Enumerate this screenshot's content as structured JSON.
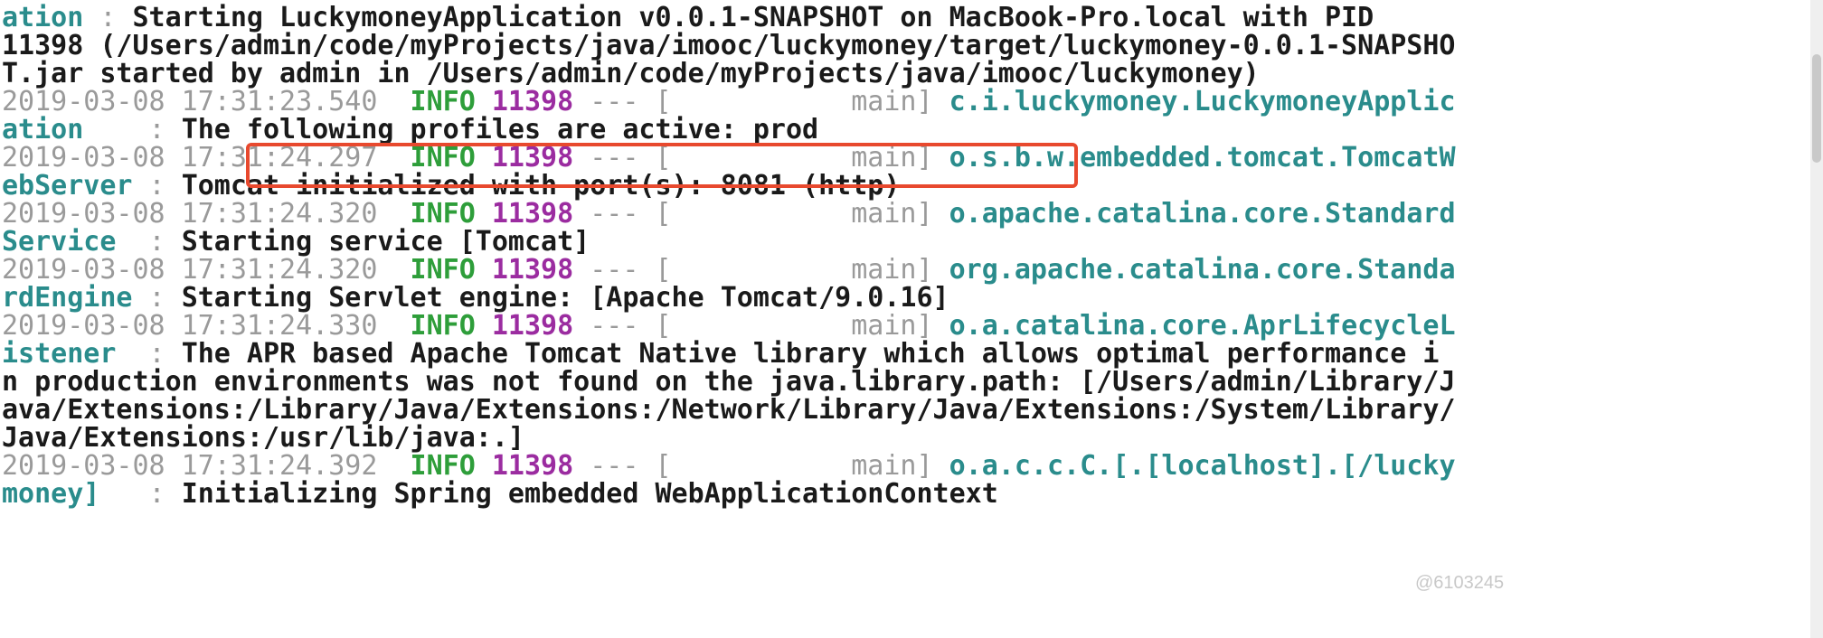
{
  "log": {
    "l1": {
      "logger": "ation",
      "colon": " : ",
      "msg": "Starting LuckymoneyApplication v0.0.1-SNAPSHOT on MacBook-Pro.local with PID"
    },
    "l2": {
      "msg": "11398 (/Users/admin/code/myProjects/java/imooc/luckymoney/target/luckymoney-0.0.1-SNAPSHO"
    },
    "l3": {
      "msg": "T.jar started by admin in /Users/admin/code/myProjects/java/imooc/luckymoney)"
    },
    "l4": {
      "ts": "2019-03-08 17:31:23.540  ",
      "lvl": "INFO",
      "pid": "11398",
      "sep": " --- [           main] ",
      "logger": "c.i.luckymoney.LuckymoneyApplic"
    },
    "l5": {
      "logger": "ation",
      "colon": "    : ",
      "msg": "The following profiles are active: prod"
    },
    "l6": {
      "ts": "2019-03-08 17:31:24.297  ",
      "lvl": "INFO",
      "pid": "11398",
      "sep": " --- [           main] ",
      "logger": "o.s.b.w.embedded.tomcat.TomcatW"
    },
    "l7": {
      "logger": "ebServer",
      "colon": " : ",
      "msg": "Tomcat initialized with port(s): 8081 (http)"
    },
    "l8": {
      "ts": "2019-03-08 17:31:24.320  ",
      "lvl": "INFO",
      "pid": "11398",
      "sep": " --- [           main] ",
      "logger": "o.apache.catalina.core.Standard"
    },
    "l9": {
      "logger": "Service",
      "colon": "  : ",
      "msg": "Starting service [Tomcat]"
    },
    "l10": {
      "ts": "2019-03-08 17:31:24.320  ",
      "lvl": "INFO",
      "pid": "11398",
      "sep": " --- [           main] ",
      "logger": "org.apache.catalina.core.Standa"
    },
    "l11": {
      "logger": "rdEngine",
      "colon": " : ",
      "msg": "Starting Servlet engine: [Apache Tomcat/9.0.16]"
    },
    "l12": {
      "ts": "2019-03-08 17:31:24.330  ",
      "lvl": "INFO",
      "pid": "11398",
      "sep": " --- [           main] ",
      "logger": "o.a.catalina.core.AprLifecycleL"
    },
    "l13": {
      "logger": "istener",
      "colon": "  : ",
      "msg": "The APR based Apache Tomcat Native library which allows optimal performance i"
    },
    "l14": {
      "msg": "n production environments was not found on the java.library.path: [/Users/admin/Library/J"
    },
    "l15": {
      "msg": "ava/Extensions:/Library/Java/Extensions:/Network/Library/Java/Extensions:/System/Library/"
    },
    "l16": {
      "msg": "Java/Extensions:/usr/lib/java:.]"
    },
    "l17": {
      "ts": "2019-03-08 17:31:24.392  ",
      "lvl": "INFO",
      "pid": "11398",
      "sep": " --- [           main] ",
      "logger": "o.a.c.c.C.[.[localhost].[/lucky"
    },
    "l18": {
      "logger": "money]",
      "colon": "   : ",
      "msg": "Initializing Spring embedded WebApplicationContext"
    }
  },
  "watermark": "@6103245",
  "colors": {
    "timestamp": "#9a9a9a",
    "level": "#2e9e3a",
    "pid": "#9b2ca0",
    "logger": "#2a8c8c",
    "message": "#1a1a1a",
    "highlight": "#e8492e"
  }
}
